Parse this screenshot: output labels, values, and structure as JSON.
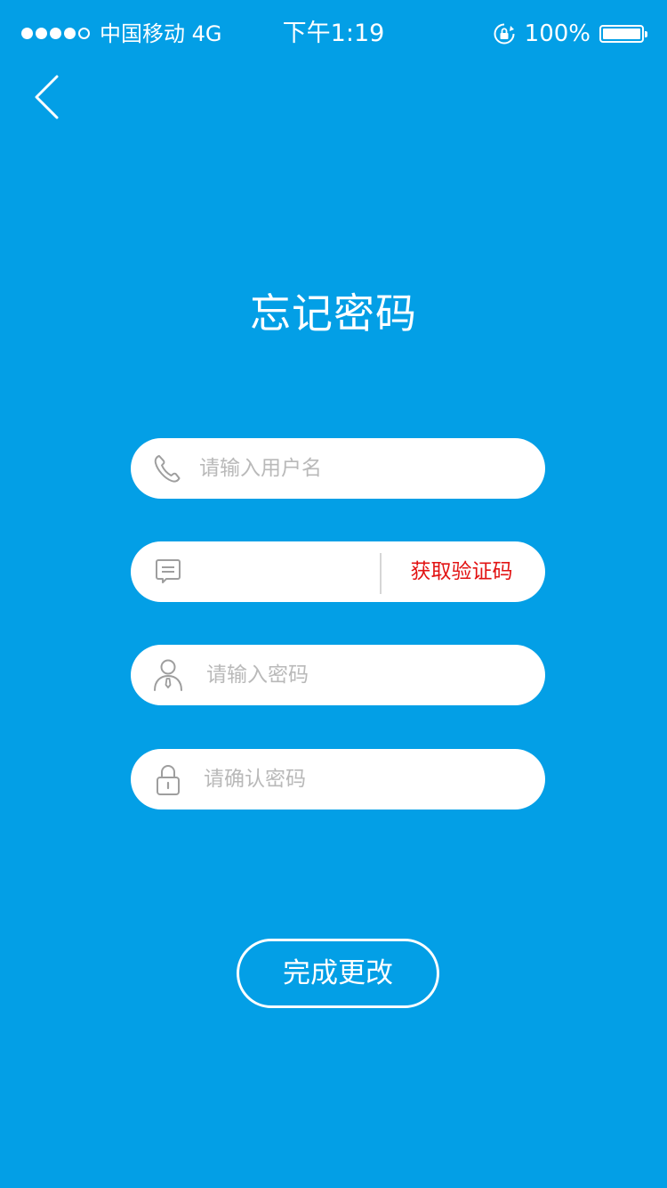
{
  "status_bar": {
    "signal_filled": 4,
    "signal_total": 5,
    "carrier": "中国移动  4G",
    "time": "下午1:19",
    "battery_percent": "100%",
    "battery_level": 1.0
  },
  "page": {
    "title": "忘记密码"
  },
  "form": {
    "username": {
      "placeholder": "请输入用户名",
      "value": "",
      "icon": "phone-icon"
    },
    "code": {
      "placeholder": "",
      "value": "",
      "icon": "message-icon",
      "button_label": "获取验证码"
    },
    "password": {
      "placeholder": "请输入密码",
      "value": "",
      "icon": "user-icon"
    },
    "confirm": {
      "placeholder": "请确认密码",
      "value": "",
      "icon": "lock-icon"
    },
    "submit_label": "完成更改"
  },
  "colors": {
    "background": "#039fe6",
    "code_button": "#e21313",
    "placeholder": "#b9b9b9"
  }
}
